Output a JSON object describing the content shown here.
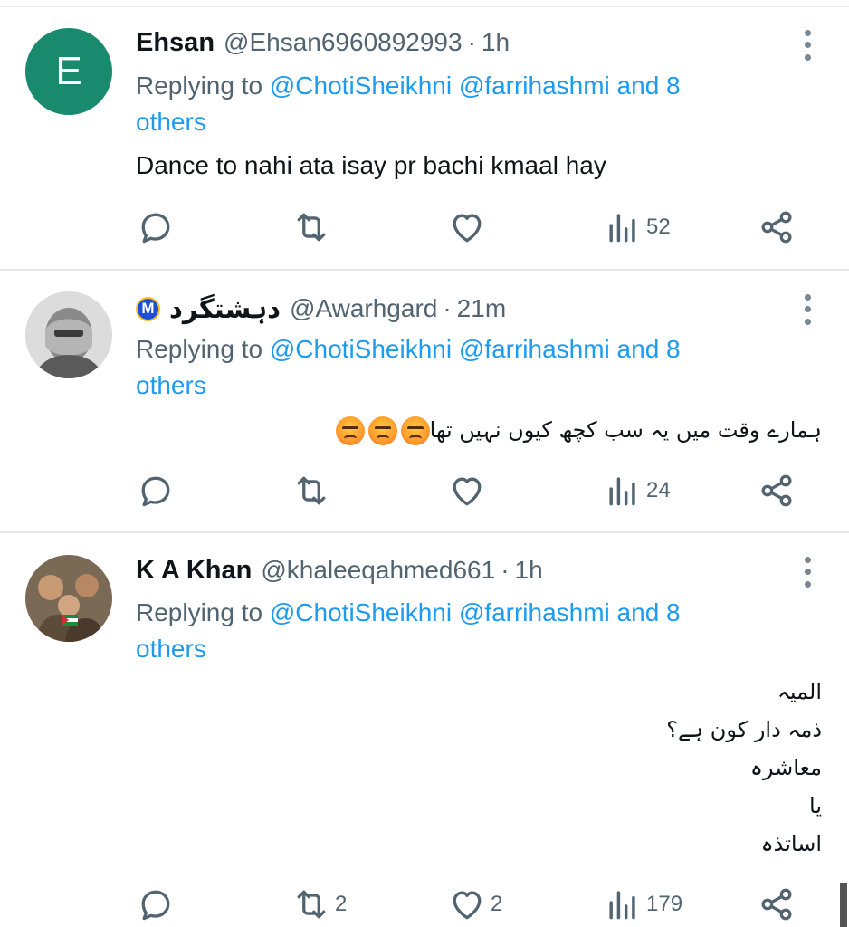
{
  "tweets": [
    {
      "avatar_letter": "E",
      "avatar_color": "#1a8a6e",
      "name": "Ehsan",
      "handle": "@Ehsan6960892993",
      "separator": "·",
      "time": "1h",
      "replying_prefix": "Replying to",
      "mention_1": "@ChotiSheikhni",
      "mention_2": "@farrihashmi",
      "and_others_1": "and 8",
      "and_others_2": "others",
      "text": "Dance to nahi ata isay pr bachi kmaal hay",
      "actions": {
        "reply_count": "",
        "retweet_count": "",
        "like_count": "",
        "views_count": "52"
      }
    },
    {
      "avatar_icon": "masked-person-avatar",
      "verified_badge": "M",
      "name": "دہشتگرد",
      "handle": "@Awarhgard",
      "separator": "·",
      "time": "21m",
      "replying_prefix": "Replying to",
      "mention_1": "@ChotiSheikhni",
      "mention_2": "@farrihashmi",
      "and_others_1": "and 8",
      "and_others_2": "others",
      "text": "ہمارے وقت میں یہ سب کچھ کیوں نہیں تھا",
      "emoji": "angry-face-emoji",
      "actions": {
        "reply_count": "",
        "retweet_count": "",
        "like_count": "",
        "views_count": "24"
      }
    },
    {
      "avatar_icon": "children-photo-avatar",
      "name": "K A Khan",
      "handle": "@khaleeqahmed661",
      "separator": "·",
      "time": "1h",
      "replying_prefix": "Replying to",
      "mention_1": "@ChotiSheikhni",
      "mention_2": "@farrihashmi",
      "and_others_1": "and 8",
      "and_others_2": "others",
      "lines": [
        "المیہ",
        "ذمہ دار کون ہے؟",
        "معاشرہ",
        "یا",
        "اساتذہ"
      ],
      "actions": {
        "reply_count": "",
        "retweet_count": "2",
        "like_count": "2",
        "views_count": "179"
      }
    }
  ],
  "colors": {
    "link": "#1d9bf0",
    "muted": "#536471",
    "text": "#0f1419",
    "divider": "#e7e9ea"
  }
}
